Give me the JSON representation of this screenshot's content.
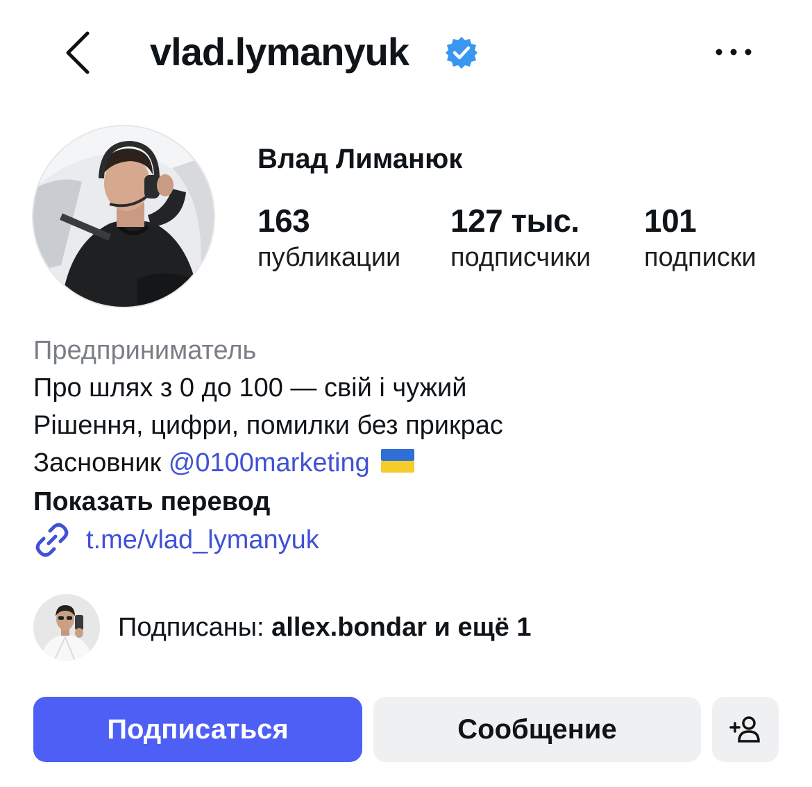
{
  "header": {
    "username": "vlad.lymanyuk",
    "icons": {
      "back": "chevron-left-icon",
      "verified": "verified-badge-icon",
      "more": "more-horizontal-icon"
    },
    "verified_color": "#3897f0"
  },
  "profile": {
    "full_name": "Влад Лиманюк",
    "stats": [
      {
        "value": "163",
        "label": "публикации"
      },
      {
        "value": "127 тыс.",
        "label": "подписчики"
      },
      {
        "value": "101",
        "label": "подписки"
      }
    ]
  },
  "bio": {
    "category": "Предприниматель",
    "lines": [
      "Про шлях з 0 до 100 — свій і чужий",
      "Рішення, цифри, помилки без прикрас"
    ],
    "founder_prefix": "Засновник ",
    "mention": "@0100marketing",
    "flag_icon": "ukraine-flag-icon",
    "show_translation": "Показать перевод",
    "link": "t.me/vlad_lymanyuk",
    "link_icon": "link-icon"
  },
  "followed_by": {
    "prefix": "Подписаны: ",
    "user": "allex.bondar",
    "suffix": " и ещё 1"
  },
  "actions": {
    "follow": "Подписаться",
    "message": "Сообщение",
    "add_icon": "add-person-icon"
  },
  "colors": {
    "accent": "#4d5ff5",
    "link": "#3f51d6",
    "button_secondary": "#eff0f2",
    "muted": "#7a7f86"
  }
}
